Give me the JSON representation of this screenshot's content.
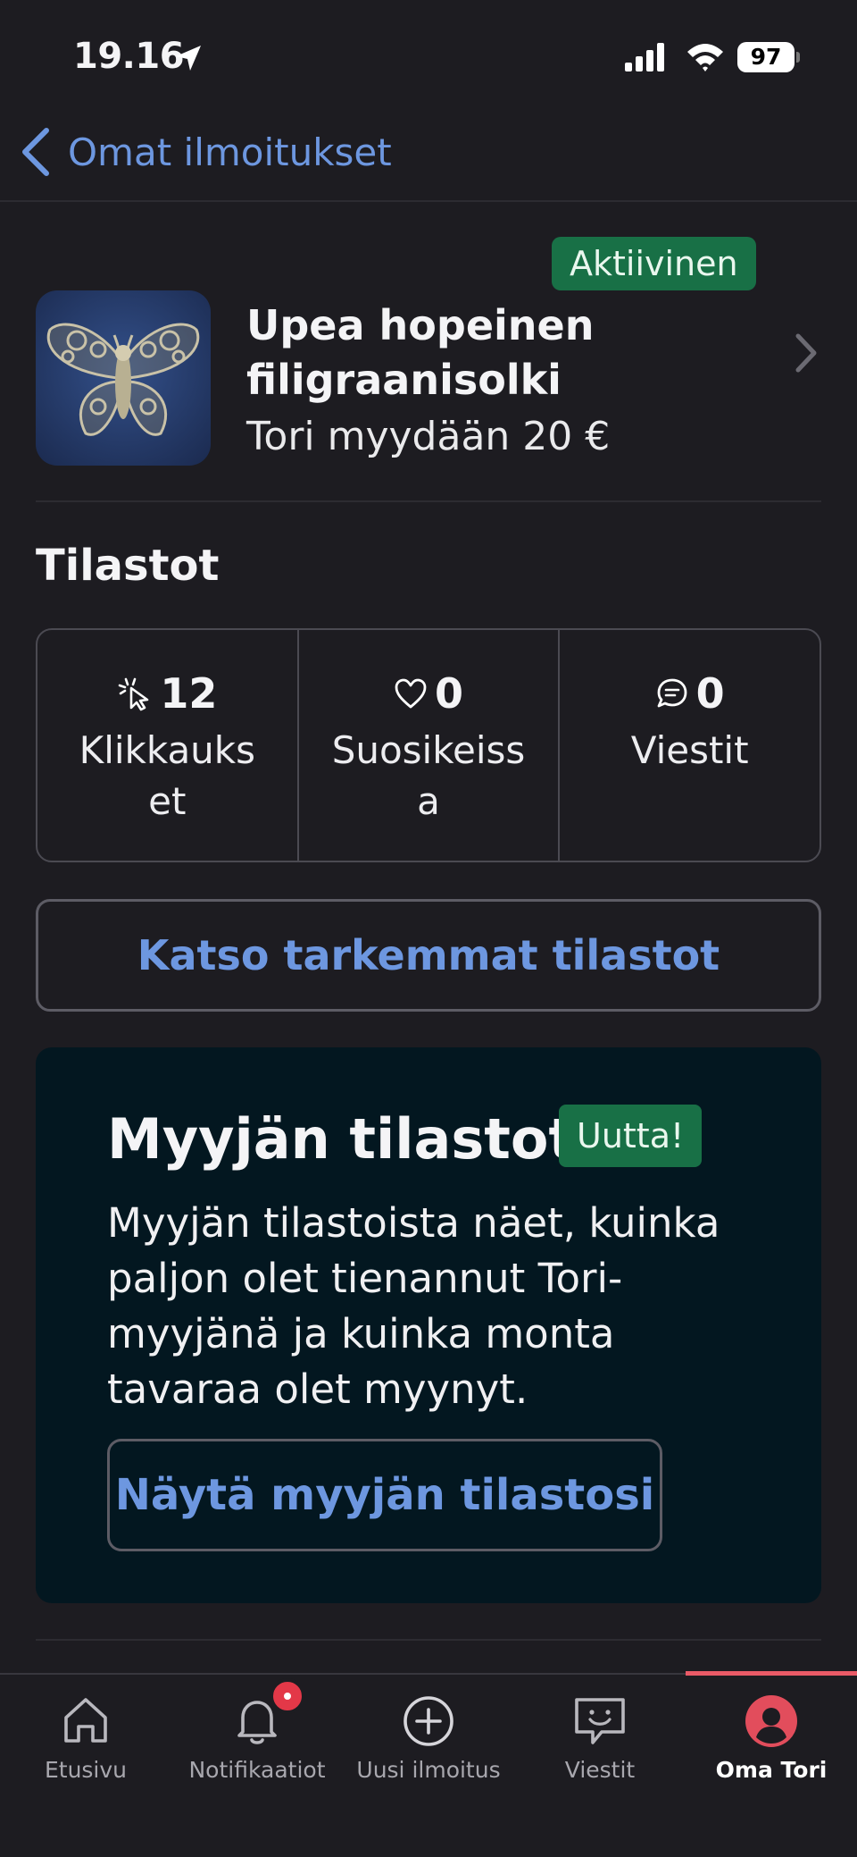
{
  "status_bar": {
    "time": "19.16",
    "battery": "97"
  },
  "nav": {
    "back_label": "Omat ilmoitukset"
  },
  "listing": {
    "status": "Aktiivinen",
    "title": "Upea hopeinen filigraanisolki",
    "price": "Tori myydään 20 €"
  },
  "stats": {
    "title": "Tilastot",
    "items": [
      {
        "icon": "cursor-click-icon",
        "value": "12",
        "label": "Klikkaukset"
      },
      {
        "icon": "heart-icon",
        "value": "0",
        "label": "Suosikeissa"
      },
      {
        "icon": "chat-bubble-icon",
        "value": "0",
        "label": "Viestit"
      }
    ],
    "details_button": "Katso tarkemmat tilastot"
  },
  "seller_stats": {
    "title": "Myyjän tilastot",
    "badge": "Uutta!",
    "description": "Myyjän tilastoista näet, kuinka paljon olet tienannut Tori-myyjänä ja kuinka monta tavaraa olet myynyt.",
    "button": "Näytä myyjän tilastosi"
  },
  "tabbar": {
    "items": [
      {
        "label": "Etusivu",
        "icon": "home-icon"
      },
      {
        "label": "Notifikaatiot",
        "icon": "bell-icon"
      },
      {
        "label": "Uusi ilmoitus",
        "icon": "plus-circle-icon"
      },
      {
        "label": "Viestit",
        "icon": "message-smile-icon"
      },
      {
        "label": "Oma Tori",
        "icon": "profile-icon"
      }
    ],
    "active": "Oma Tori"
  },
  "colors": {
    "background": "#1d1c21",
    "accent_blue": "#6d97e0",
    "badge_green": "#187046",
    "promo_bg": "#031720",
    "active_tab": "#ea5a67"
  }
}
